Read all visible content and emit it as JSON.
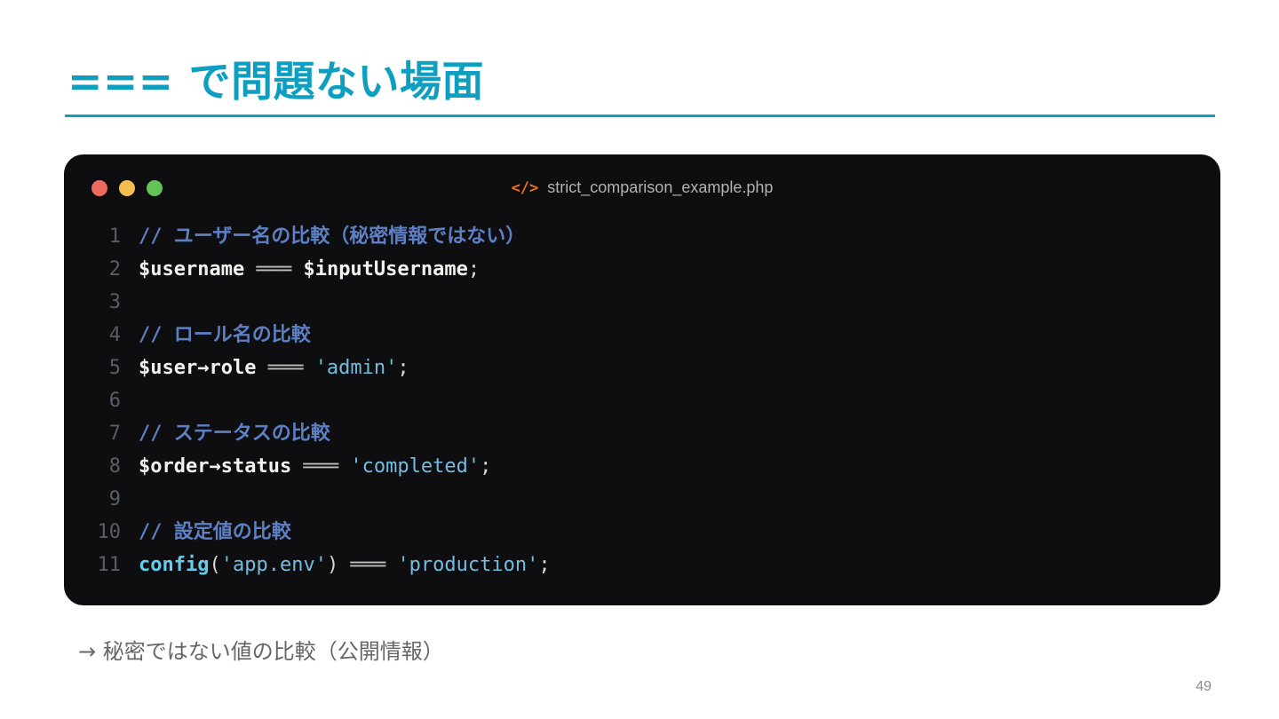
{
  "slide": {
    "title": "=== で問題ない場面",
    "note": "→ 秘密ではない値の比較（公開情報）",
    "page_number": "49"
  },
  "code_window": {
    "filename": "strict_comparison_example.php",
    "file_icon": "</>",
    "file_icon_name": "code-icon",
    "traffic_lights": [
      "#ec6a5e",
      "#f4bf4f",
      "#61c454"
    ],
    "file_icon_color": "#f36f21",
    "lines": [
      {
        "n": "1",
        "tokens": [
          {
            "t": "comment",
            "v": "// ユーザー名の比較（秘密情報ではない）"
          }
        ]
      },
      {
        "n": "2",
        "tokens": [
          {
            "t": "var",
            "v": "$username"
          },
          {
            "t": "op",
            "v": " ═══ "
          },
          {
            "t": "var",
            "v": "$inputUsername"
          },
          {
            "t": "punc",
            "v": ";"
          }
        ]
      },
      {
        "n": "3",
        "tokens": []
      },
      {
        "n": "4",
        "tokens": [
          {
            "t": "comment",
            "v": "// ロール名の比較"
          }
        ]
      },
      {
        "n": "5",
        "tokens": [
          {
            "t": "var",
            "v": "$user→role"
          },
          {
            "t": "op",
            "v": " ═══ "
          },
          {
            "t": "str",
            "v": "'admin'"
          },
          {
            "t": "punc",
            "v": ";"
          }
        ]
      },
      {
        "n": "6",
        "tokens": []
      },
      {
        "n": "7",
        "tokens": [
          {
            "t": "comment",
            "v": "// ステータスの比較"
          }
        ]
      },
      {
        "n": "8",
        "tokens": [
          {
            "t": "var",
            "v": "$order→status"
          },
          {
            "t": "op",
            "v": " ═══ "
          },
          {
            "t": "str",
            "v": "'completed'"
          },
          {
            "t": "punc",
            "v": ";"
          }
        ]
      },
      {
        "n": "9",
        "tokens": []
      },
      {
        "n": "10",
        "tokens": [
          {
            "t": "comment",
            "v": "// 設定値の比較"
          }
        ]
      },
      {
        "n": "11",
        "tokens": [
          {
            "t": "fn",
            "v": "config"
          },
          {
            "t": "punc",
            "v": "("
          },
          {
            "t": "str",
            "v": "'app.env'"
          },
          {
            "t": "punc",
            "v": ")"
          },
          {
            "t": "op",
            "v": " ═══ "
          },
          {
            "t": "str",
            "v": "'production'"
          },
          {
            "t": "punc",
            "v": ";"
          }
        ]
      }
    ]
  },
  "colors": {
    "accent": "#0e9fc0",
    "code_background": "#0e0e10",
    "comment": "#5d80c4",
    "string": "#74bde0",
    "function": "#66cbea"
  }
}
